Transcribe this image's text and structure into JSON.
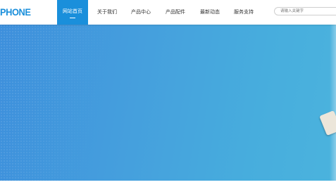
{
  "header": {
    "logo_text": "PHONE",
    "nav": [
      {
        "label": "网站首页",
        "active": true
      },
      {
        "label": "关于我们",
        "active": false
      },
      {
        "label": "产品中心",
        "active": false
      },
      {
        "label": "产品配件",
        "active": false
      },
      {
        "label": "最新动态",
        "active": false
      },
      {
        "label": "服务支持",
        "active": false
      }
    ],
    "search": {
      "placeholder": "请输入关键字",
      "value": ""
    }
  },
  "colors": {
    "brand": "#1a8fdb",
    "banner_start": "#3d8fdc",
    "banner_end": "#4bb3dd"
  },
  "banner": {
    "image": "banner-slide"
  }
}
